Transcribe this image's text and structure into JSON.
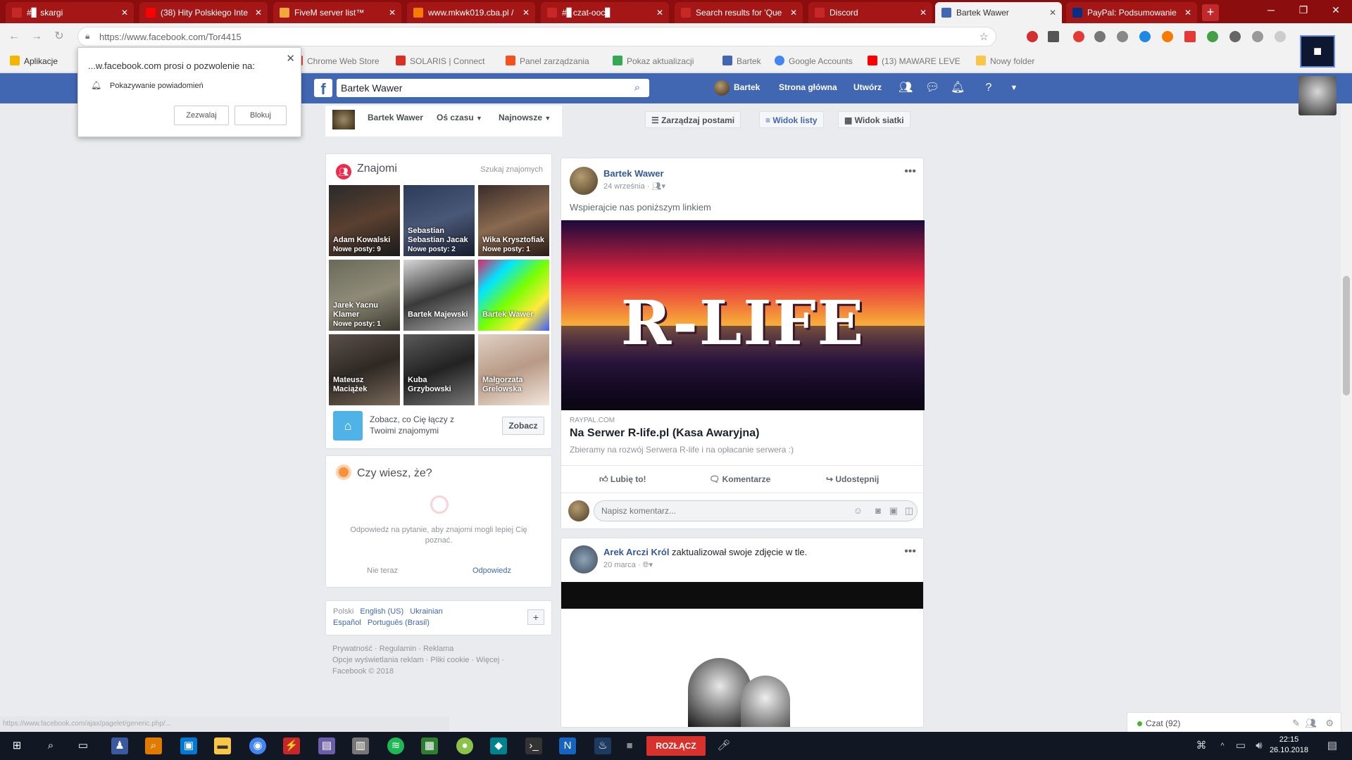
{
  "browser": {
    "tabs": [
      {
        "label": "#▊ skargi",
        "color": "#c62828"
      },
      {
        "label": "(38) Hity Polskiego Inte",
        "color": "#ff0000"
      },
      {
        "label": "FiveM server list™",
        "color": "#f2a73b"
      },
      {
        "label": "www.mkwk019.cba.pl /",
        "color": "#f57c00"
      },
      {
        "label": "#▊czat-ooc▊",
        "color": "#c62828"
      },
      {
        "label": "Search results for 'Que",
        "color": "#c62828"
      },
      {
        "label": "Discord",
        "color": "#c62828"
      },
      {
        "label": "Bartek Wawer",
        "color": "#4267b2"
      },
      {
        "label": "PayPal: Podsumowanie",
        "color": "#003087"
      }
    ],
    "new_tab": "+",
    "url": "https://www.facebook.com/Tor4415",
    "apps_label": "Aplikacje",
    "bookmarks": [
      {
        "label": "Chrome Web Store",
        "color": "#e94235"
      },
      {
        "label": "SOLARIS | Connect",
        "color": "#d93025"
      },
      {
        "label": "Panel zarządzania",
        "color": "#f4511e"
      },
      {
        "label": "Pokaz aktualizacji",
        "color": "#34a853"
      },
      {
        "label": "Bartek",
        "color": "#4267b2"
      },
      {
        "label": "Google Accounts",
        "color": "#4285f4"
      },
      {
        "label": "(13) MAWARE LEVE",
        "color": "#ff0000"
      },
      {
        "label": "Nowy folder",
        "color": "#f9c747"
      }
    ]
  },
  "notification": {
    "title": "...w.facebook.com prosi o pozwolenie na:",
    "permission": "Pokazywanie powiadomień",
    "allow": "Zezwalaj",
    "block": "Blokuj"
  },
  "facebook": {
    "search_value": "Bartek Wawer",
    "nav": {
      "profile": "Bartek",
      "home": "Strona główna",
      "create": "Utwórz"
    },
    "profile_tabs": {
      "name": "Bartek Wawer",
      "timeline": "Oś czasu",
      "newest": "Najnowsze"
    },
    "feed_tools": {
      "manage": "Zarządzaj postami",
      "list_view": "Widok listy",
      "grid_view": "Widok siatki"
    },
    "friends": {
      "title": "Znajomi",
      "find": "Szukaj znajomych",
      "tiles": [
        {
          "name": "Adam Kowalski",
          "posts": "Nowe posty: 9"
        },
        {
          "name": "Sebastian Sebastian Jacak",
          "posts": "Nowe posty: 2"
        },
        {
          "name": "Wika Krysztofiak",
          "posts": "Nowe posty: 1"
        },
        {
          "name": "Jarek Yacnu Klamer",
          "posts": "Nowe posty: 1"
        },
        {
          "name": "Bartek Majewski",
          "posts": ""
        },
        {
          "name": "Bartek Wawer",
          "posts": ""
        },
        {
          "name": "Mateusz Maciążek",
          "posts": ""
        },
        {
          "name": "Kuba Grzybowski",
          "posts": ""
        },
        {
          "name": "Małgorzata Grelowska",
          "posts": ""
        }
      ],
      "connect_text": "Zobacz, co Cię łączy z Twoimi znajomymi",
      "connect_btn": "Zobacz"
    },
    "did_you_know": {
      "title": "Czy wiesz, że?",
      "body": "Odpowiedz na pytanie, aby znajomi mogli lepiej Cię poznać.",
      "skip": "Nie teraz",
      "answer": "Odpowiedz"
    },
    "languages": {
      "line1": [
        "Polski",
        "English (US)",
        "Ukrainian"
      ],
      "line2": [
        "Español",
        "Português (Brasil)"
      ],
      "add": "+"
    },
    "footer": {
      "line1": "Prywatność · Regulamin · Reklama",
      "line2": "Opcje wyświetlania reklam · Pliki cookie · Więcej ·",
      "copyright": "Facebook © 2018"
    },
    "post1": {
      "author": "Bartek Wawer",
      "date": "24 września",
      "text": "Wspierajcie nas poniższym linkiem",
      "banner_text": "R-LIFE",
      "link_domain": "RAYPAL.COM",
      "link_title": "Na Serwer R-life.pl (Kasa Awaryjna)",
      "link_desc": "Zbieramy na rozwój Serwera R-life i na opłacanie serwera :)",
      "like": "Lubię to!",
      "comment": "Komentarze",
      "share": "Udostępnij",
      "comment_placeholder": "Napisz komentarz..."
    },
    "post2": {
      "author": "Arek Arczi Król",
      "action": " zaktualizował swoje zdjęcie w tle.",
      "date": "20 marca"
    },
    "chat": {
      "label": "Czat (92)"
    }
  },
  "status_url": "https://www.facebook.com/ajax/pagelet/generic.php/...",
  "taskbar": {
    "disconnect": "ROZŁĄCZ",
    "time": "22:15",
    "date": "26.10.2018"
  }
}
